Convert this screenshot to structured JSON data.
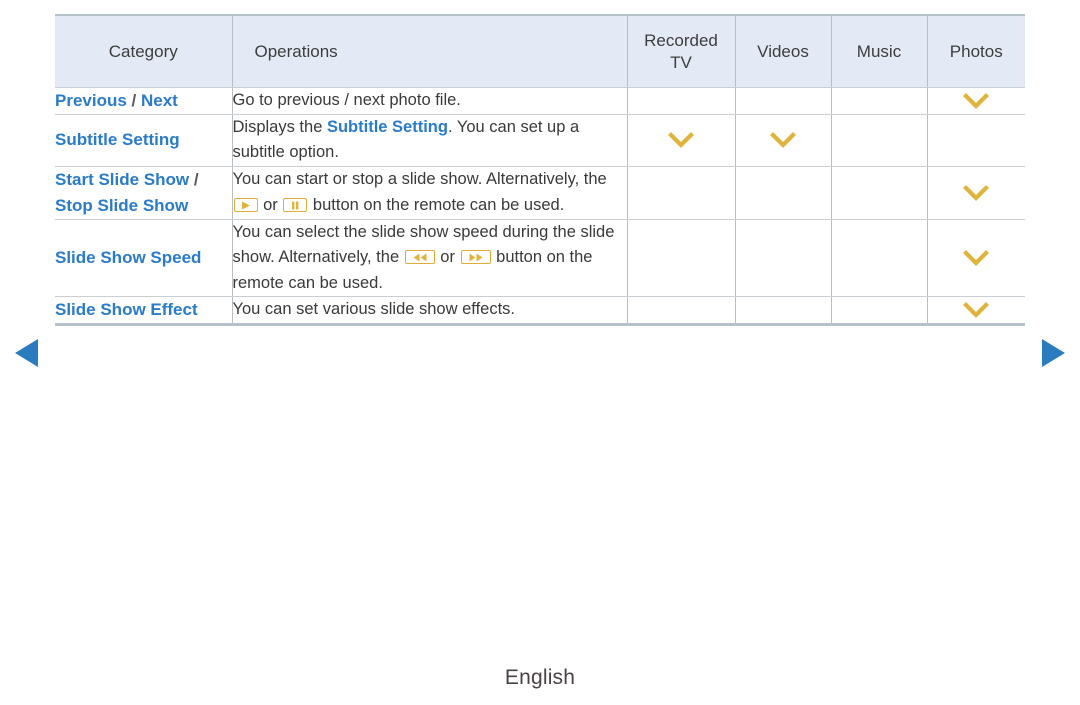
{
  "nav": {
    "prev_icon": "triangle-left-icon",
    "next_icon": "triangle-right-icon",
    "arrow_color": "#2b7cbf"
  },
  "table": {
    "headers": {
      "category": "Category",
      "operations": "Operations",
      "recorded_tv": "Recorded TV",
      "recorded_tv_line1": "Recorded",
      "recorded_tv_line2": "TV",
      "videos": "Videos",
      "music": "Music",
      "photos": "Photos"
    },
    "header_bg": "#e3eaf5",
    "accent_blue": "#2a7bc8",
    "check_color": "#e0b33c",
    "rows": [
      {
        "category_parts": [
          {
            "text": "Previous",
            "style": "link"
          },
          {
            "text": " / ",
            "style": "sep"
          },
          {
            "text": "Next",
            "style": "link"
          }
        ],
        "category_plain": "Previous / Next",
        "operations_parts": [
          {
            "text": "Go to previous / next photo file.",
            "style": "normal"
          }
        ],
        "marks": {
          "recorded_tv": false,
          "videos": false,
          "music": false,
          "photos": true
        }
      },
      {
        "category_parts": [
          {
            "text": "Subtitle Setting",
            "style": "link"
          }
        ],
        "category_plain": "Subtitle Setting",
        "operations_parts": [
          {
            "text": "Displays the ",
            "style": "normal"
          },
          {
            "text": "Subtitle Setting",
            "style": "link"
          },
          {
            "text": ". You can set up a subtitle option.",
            "style": "normal"
          }
        ],
        "marks": {
          "recorded_tv": true,
          "videos": true,
          "music": false,
          "photos": false
        }
      },
      {
        "category_parts": [
          {
            "text": "Start Slide Show",
            "style": "link"
          },
          {
            "text": " / ",
            "style": "sep"
          },
          {
            "text": "Stop Slide Show",
            "style": "link"
          }
        ],
        "category_plain": "Start Slide Show / Stop Slide Show",
        "operations_parts": [
          {
            "text": "You can start or stop a slide show. Alternatively, the ",
            "style": "normal"
          },
          {
            "text": "play-button-icon",
            "style": "key"
          },
          {
            "text": " or ",
            "style": "normal"
          },
          {
            "text": "pause-button-icon",
            "style": "key"
          },
          {
            "text": " button on the remote can be used.",
            "style": "normal"
          }
        ],
        "marks": {
          "recorded_tv": false,
          "videos": false,
          "music": false,
          "photos": true
        }
      },
      {
        "category_parts": [
          {
            "text": "Slide Show Speed",
            "style": "link"
          }
        ],
        "category_plain": "Slide Show Speed",
        "operations_parts": [
          {
            "text": "You can select the slide show speed during the slide show. Alternatively, the ",
            "style": "normal"
          },
          {
            "text": "rewind-button-icon",
            "style": "key"
          },
          {
            "text": " or ",
            "style": "normal"
          },
          {
            "text": "fast-forward-button-icon",
            "style": "key"
          },
          {
            "text": " button on the remote can be used.",
            "style": "normal"
          }
        ],
        "marks": {
          "recorded_tv": false,
          "videos": false,
          "music": false,
          "photos": true
        }
      },
      {
        "category_parts": [
          {
            "text": "Slide Show Effect",
            "style": "link"
          }
        ],
        "category_plain": "Slide Show Effect",
        "operations_parts": [
          {
            "text": "You can set various slide show effects.",
            "style": "normal"
          }
        ],
        "marks": {
          "recorded_tv": false,
          "videos": false,
          "music": false,
          "photos": true
        }
      }
    ]
  },
  "footer": {
    "language": "English"
  }
}
